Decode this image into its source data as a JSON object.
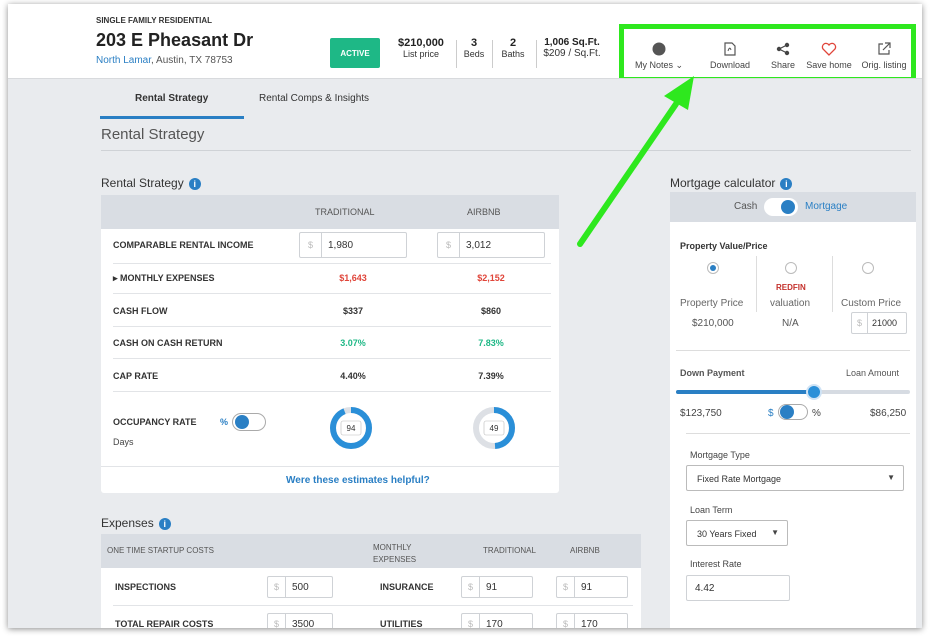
{
  "header": {
    "property_type": "SINGLE FAMILY RESIDENTIAL",
    "address": "203 E Pheasant Dr",
    "neighborhood": "North Lamar",
    "city": ", Austin, TX 78753",
    "status": "ACTIVE",
    "price": "$210,000",
    "price_label": "List price",
    "beds": "3",
    "beds_label": "Beds",
    "baths": "2",
    "baths_label": "Baths",
    "sqft": "1,006 Sq.Ft.",
    "price_per_sqft": "$209 / Sq.Ft."
  },
  "actions": {
    "notes": "My Notes",
    "download": "Download",
    "share": "Share",
    "save": "Save home",
    "listing": "Orig. listing"
  },
  "tabs": [
    "Rental Strategy",
    "Rental Comps & Insights"
  ],
  "page_title": "Rental Strategy",
  "strategy": {
    "title": "Rental Strategy",
    "col_traditional": "TRADITIONAL",
    "col_airbnb": "AIRBNB",
    "income_label": "COMPARABLE RENTAL INCOME",
    "income_trad": "1,980",
    "income_air": "3,012",
    "expenses_label": "▸ MONTHLY EXPENSES",
    "expenses_trad": "$1,643",
    "expenses_air": "$2,152",
    "cashflow_label": "CASH FLOW",
    "cashflow_trad": "$337",
    "cashflow_air": "$860",
    "coc_label": "CASH ON CASH RETURN",
    "coc_trad": "3.07%",
    "coc_air": "7.83%",
    "cap_label": "CAP RATE",
    "cap_trad": "4.40%",
    "cap_air": "7.39%",
    "occ_label": "OCCUPANCY RATE",
    "occ_pct": "%",
    "occ_days": "Days",
    "occ_trad": "94",
    "occ_air": "49",
    "helpful": "Were these estimates helpful?",
    "currency": "$"
  },
  "expenses": {
    "title": "Expenses",
    "startup_label": "ONE TIME STARTUP COSTS",
    "monthly_label": "MONTHLY EXPENSES",
    "col_traditional": "TRADITIONAL",
    "col_airbnb": "AIRBNB",
    "inspections_label": "INSPECTIONS",
    "inspections_val": "500",
    "repair_label": "TOTAL REPAIR COSTS",
    "repair_val": "3500",
    "insurance_label": "INSURANCE",
    "insurance_trad": "91",
    "insurance_air": "91",
    "utilities_label": "UTILITIES",
    "utilities_trad": "170",
    "utilities_air": "170"
  },
  "mortgage": {
    "title": "Mortgage calculator",
    "cash": "Cash",
    "mortgage": "Mortgage",
    "value_label": "Property Value/Price",
    "opt1_label": "Property Price",
    "opt1_val": "$210,000",
    "redfin": "REDFIN",
    "opt2_label": "valuation",
    "opt2_val": "N/A",
    "opt3_label": "Custom Price",
    "opt3_val": "21000",
    "down_label": "Down Payment",
    "loan_label": "Loan Amount",
    "down_val": "$123,750",
    "loan_val": "$86,250",
    "toggle_left": "$",
    "toggle_right": "%",
    "type_label": "Mortgage Type",
    "type_val": "Fixed Rate Mortgage",
    "term_label": "Loan Term",
    "term_val": "30 Years Fixed",
    "rate_label": "Interest Rate",
    "rate_val": "4.42",
    "down_fraction": 0.59
  },
  "occupancy": {
    "trad_fraction": 0.94,
    "air_fraction": 0.49
  }
}
